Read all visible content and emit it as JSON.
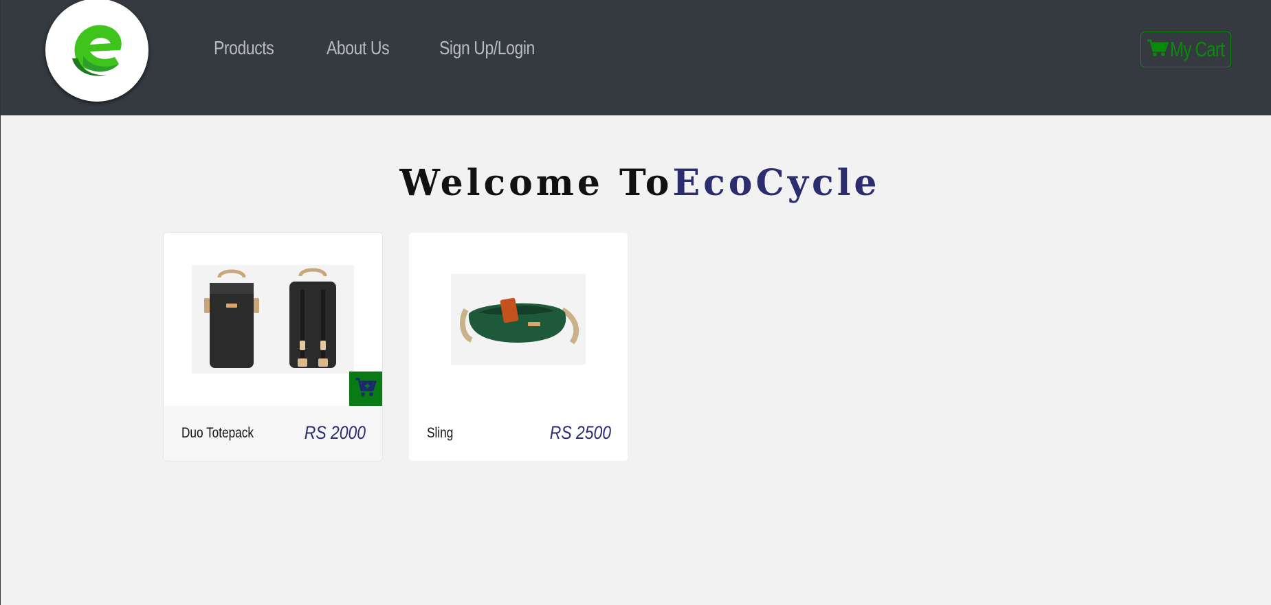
{
  "nav": {
    "logo_icon": "ecocycle-logo",
    "links": [
      "Products",
      "About Us",
      "Sign Up/Login"
    ],
    "cart_label": "My Cart",
    "cart_icon": "shopping-cart-icon"
  },
  "hero": {
    "welcome_prefix": "Welcome To",
    "brand": "EcoCycle"
  },
  "products": [
    {
      "name": "Duo Totepack",
      "price": "RS 2000",
      "image": "backpack-image",
      "add_icon": "add-to-cart-icon"
    },
    {
      "name": "Sling",
      "price": "RS 2500",
      "image": "sling-bag-image"
    }
  ],
  "colors": {
    "navbar": "#343a40",
    "accent_green": "#0a8a0a",
    "brand_blue": "#2b2d6e",
    "page_bg": "#f2f2f2"
  }
}
